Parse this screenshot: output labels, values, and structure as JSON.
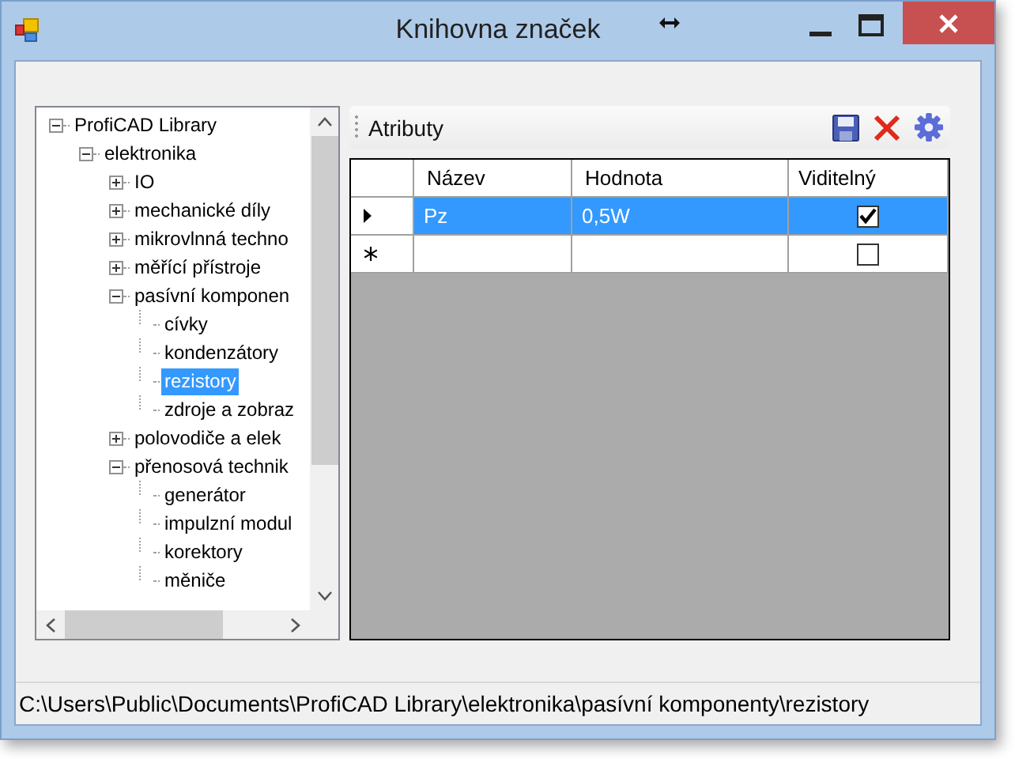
{
  "window": {
    "title": "Knihovna značek"
  },
  "tree": [
    {
      "label": "ProfiCAD Library",
      "expanded": true,
      "selected": false,
      "children": [
        {
          "label": "elektronika",
          "expanded": true,
          "selected": false,
          "children": [
            {
              "label": "IO",
              "expanded": false,
              "selected": false
            },
            {
              "label": "mechanické díly",
              "expanded": false,
              "selected": false
            },
            {
              "label": "mikrovlnná techno",
              "expanded": false,
              "selected": false
            },
            {
              "label": "měřící přístroje",
              "expanded": false,
              "selected": false
            },
            {
              "label": "pasívní komponen",
              "expanded": true,
              "selected": false,
              "children": [
                {
                  "label": "cívky",
                  "selected": false
                },
                {
                  "label": "kondenzátory",
                  "selected": false
                },
                {
                  "label": "rezistory",
                  "selected": true
                },
                {
                  "label": "zdroje a zobraz",
                  "selected": false
                }
              ]
            },
            {
              "label": "polovodiče a elek",
              "expanded": false,
              "selected": false
            },
            {
              "label": "přenosová technik",
              "expanded": true,
              "selected": false,
              "children": [
                {
                  "label": "generátor",
                  "selected": false
                },
                {
                  "label": "impulzní modul",
                  "selected": false
                },
                {
                  "label": "korektory",
                  "selected": false
                },
                {
                  "label": "měniče",
                  "selected": false
                }
              ]
            }
          ]
        }
      ]
    }
  ],
  "toolbar": {
    "title": "Atributy"
  },
  "grid": {
    "columns": [
      "Název",
      "Hodnota",
      "Viditelný"
    ],
    "rows": [
      {
        "kind": "current",
        "selected": true,
        "cells": [
          "Pz",
          "0,5W"
        ],
        "visible": true
      },
      {
        "kind": "new",
        "selected": false,
        "cells": [
          "",
          ""
        ],
        "visible": false
      }
    ]
  },
  "status_bar": "C:\\Users\\Public\\Documents\\ProfiCAD Library\\elektronika\\pasívní komponenty\\rezistory"
}
